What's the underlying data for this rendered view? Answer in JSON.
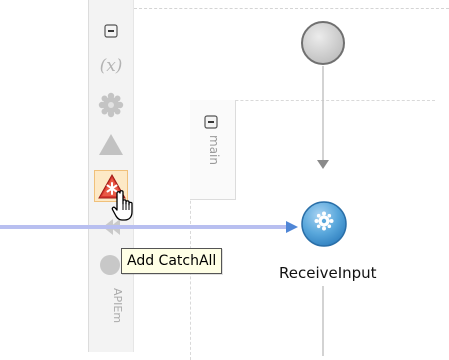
{
  "tooltip": {
    "text": "Add CatchAll"
  },
  "activity": {
    "label": "ReceiveInput"
  },
  "scope": {
    "label": "main"
  },
  "toolbar": {
    "bottom_label": "APIEm",
    "variables_label": "(x)",
    "items": [
      {
        "icon": "collapse-icon"
      },
      {
        "icon": "variables-icon"
      },
      {
        "icon": "correlation-icon"
      },
      {
        "icon": "add-catch-icon"
      },
      {
        "icon": "add-catchall-icon"
      },
      {
        "icon": "compensation-icon"
      },
      {
        "icon": "event-handler-icon"
      }
    ]
  },
  "colors": {
    "connector": "#b8bff0",
    "activity_fill": "#5aa8dc",
    "catchall_red": "#d8372e",
    "start_gray": "#c8c8c8"
  }
}
